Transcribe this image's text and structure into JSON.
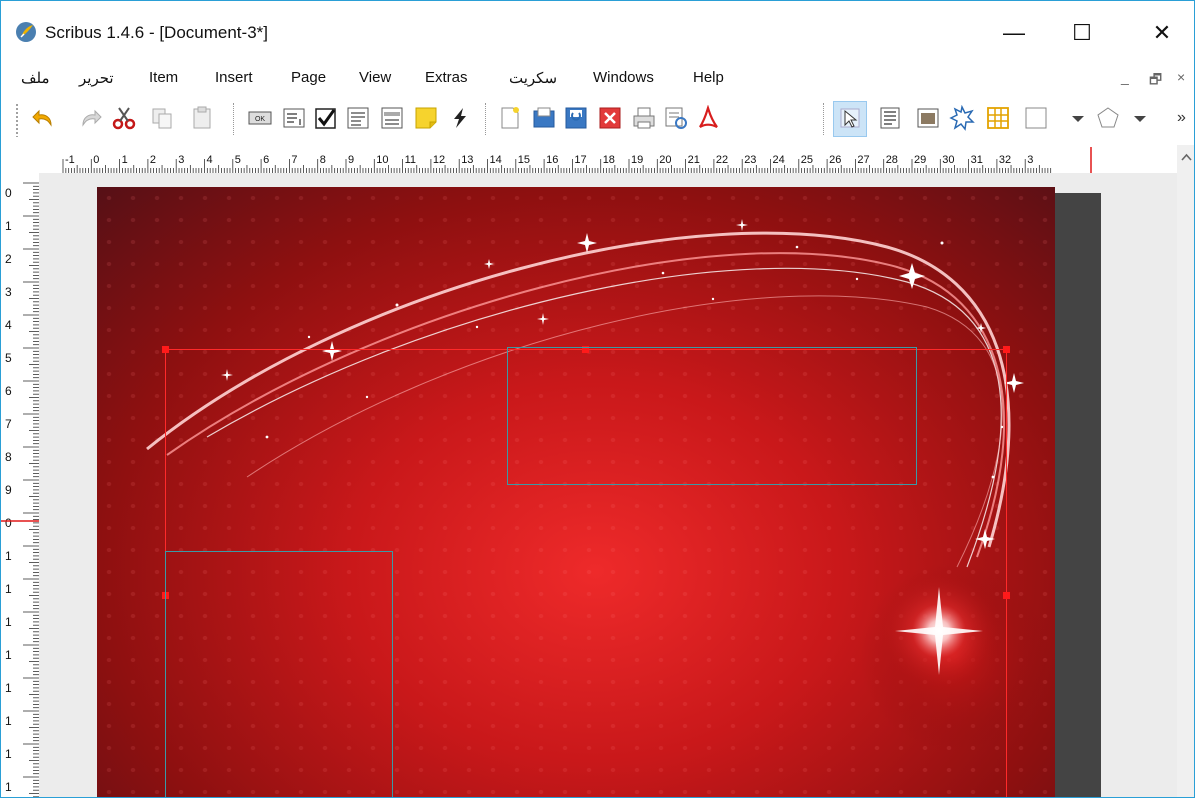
{
  "window": {
    "title": "Scribus 1.4.6 - [Document-3*]",
    "controls": {
      "minimize": "—",
      "maximize": "☐",
      "close": "✕"
    }
  },
  "menubar": {
    "items": [
      "ملف",
      "تحرير",
      "Item",
      "Insert",
      "Page",
      "View",
      "Extras",
      "سكريت",
      "Windows",
      "Help"
    ],
    "mdi_controls": [
      "_",
      "🗗",
      "×"
    ]
  },
  "toolbar": {
    "overflow": "»",
    "icons": [
      "undo-icon",
      "redo-icon",
      "cut-icon",
      "copy-icon",
      "paste-icon",
      "pdf-push-button-icon",
      "pdf-text-field-icon",
      "pdf-checkbox-icon",
      "pdf-combo-box-icon",
      "pdf-list-box-icon",
      "text-annotation-icon",
      "link-annotation-icon",
      "new-document-icon",
      "open-document-icon",
      "save-document-icon",
      "close-document-icon",
      "print-icon",
      "preflight-verifier-icon",
      "export-pdf-icon",
      "select-item-icon",
      "text-frame-icon",
      "image-frame-icon",
      "render-frame-icon",
      "table-icon",
      "shape-icon",
      "polygon-icon"
    ]
  },
  "ruler": {
    "horizontal_labels": [
      "-1",
      "0",
      "1",
      "2",
      "3",
      "4",
      "5",
      "6",
      "7",
      "8",
      "9",
      "10",
      "11",
      "12",
      "13",
      "14",
      "15",
      "16",
      "17",
      "18",
      "19",
      "20",
      "21",
      "22",
      "23",
      "24",
      "25",
      "26",
      "27",
      "28",
      "29",
      "30",
      "31",
      "32",
      "3"
    ],
    "vertical_labels": [
      "0",
      "1",
      "2",
      "3",
      "4",
      "5",
      "6",
      "7",
      "8",
      "9",
      "0",
      "1",
      "1",
      "1",
      "1",
      "1",
      "1",
      "1",
      "1"
    ]
  },
  "colors": {
    "accent_border": "#2a9fd6",
    "margin_guide": "#ff2a2a",
    "frame_outline": "#3a9aa6",
    "page_background": "#c9181a"
  }
}
